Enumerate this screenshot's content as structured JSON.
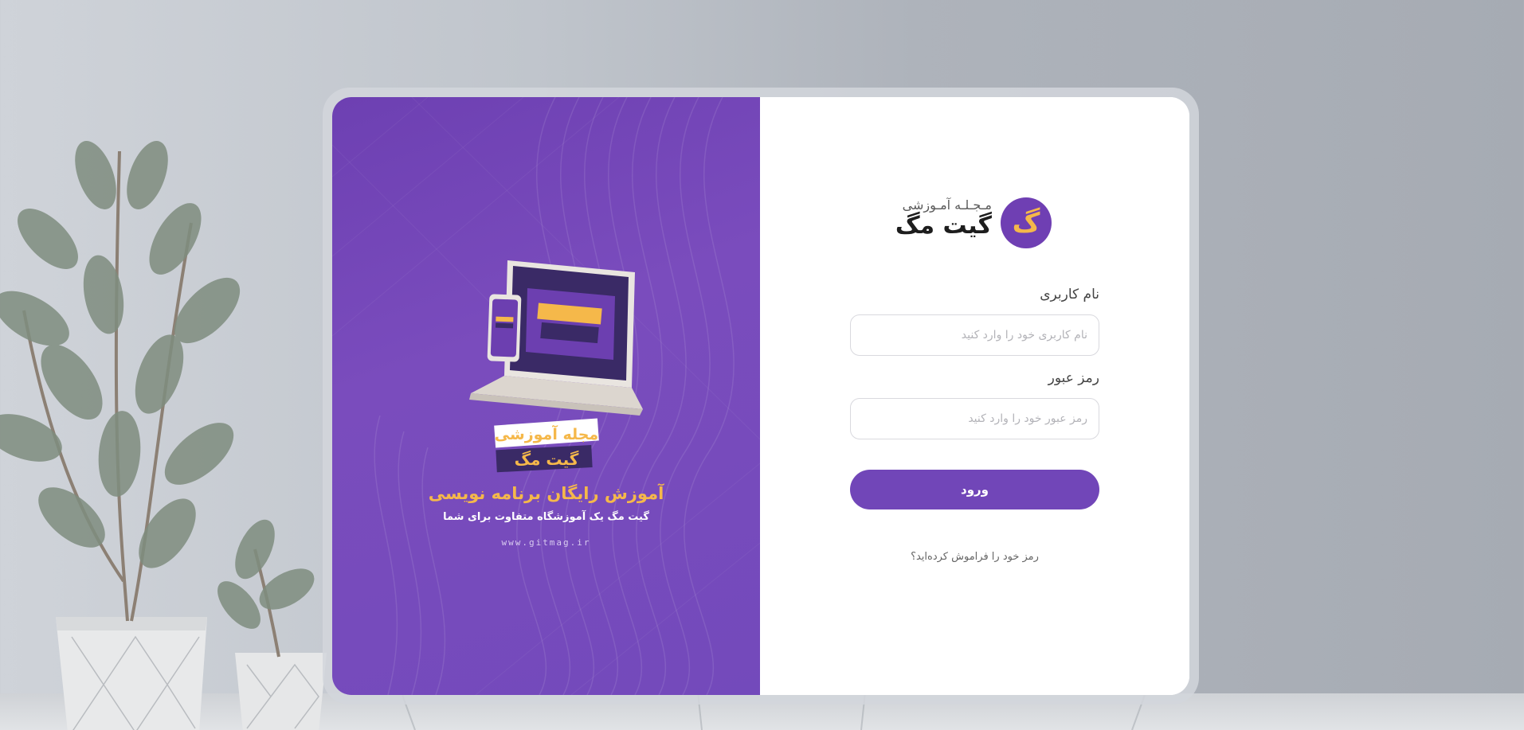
{
  "colors": {
    "brand_purple": "#7146b8",
    "brand_gold": "#f5b84a",
    "card_bg": "#ffffff"
  },
  "promo": {
    "logo_line1": "مجله آموزشی",
    "logo_line2": "گیت مگ",
    "headline": "آموزش رایگان برنامه نویسی",
    "subheadline": "گیت مگ یک آموزشگاه متفاوت برای شما",
    "url": "www.gitmag.ir"
  },
  "brand": {
    "tagline": "مـجـلـه آمـوزشی",
    "name": "گیت مگ",
    "mark_glyph": "گ"
  },
  "form": {
    "username": {
      "label": "نام کاربری",
      "placeholder": "نام کاربری خود را وارد کنید",
      "value": ""
    },
    "password": {
      "label": "رمز عبور",
      "placeholder": "رمز عبور خود را وارد کنید",
      "value": ""
    },
    "submit_label": "ورود",
    "forgot_label": "رمز خود را فراموش کرده‌اید؟"
  }
}
